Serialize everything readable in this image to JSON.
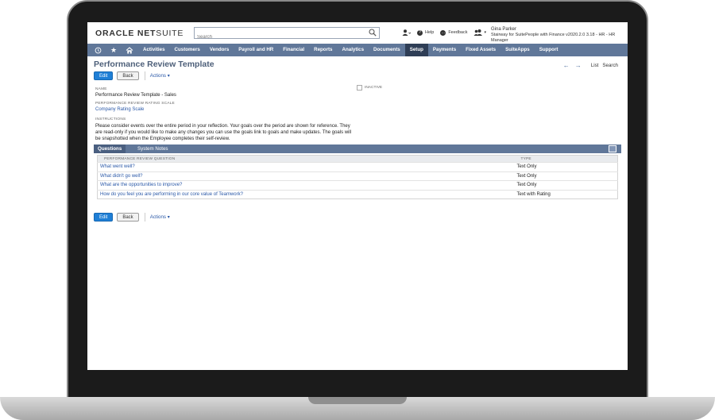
{
  "brand": {
    "oracle": "ORACLE",
    "netsuite_net": "NET",
    "netsuite_suite": "SUITE"
  },
  "search": {
    "placeholder": "Search"
  },
  "tools": {
    "help": "Help",
    "feedback": "Feedback"
  },
  "user": {
    "name": "Gina Parker",
    "role": "Stairway for SuitePeople with Finance v2020.2.0 3.18 - HR - HR Manager"
  },
  "nav": {
    "items": [
      "Activities",
      "Customers",
      "Vendors",
      "Payroll and HR",
      "Financial",
      "Reports",
      "Analytics",
      "Documents",
      "Setup",
      "Payments",
      "Fixed Assets",
      "SuiteApps",
      "Support"
    ],
    "active_index": 8
  },
  "page": {
    "title": "Performance Review Template",
    "list_link": "List",
    "search_link": "Search",
    "edit_label": "Edit",
    "back_label": "Back",
    "actions_label": "Actions ▾"
  },
  "fields": {
    "name_label": "NAME",
    "name_value": "Performance Review Template - Sales",
    "scale_label": "PERFORMANCE REVIEW RATING SCALE",
    "scale_value": "Company Rating Scale",
    "inactive_label": "INACTIVE",
    "instructions_label": "INSTRUCTIONS",
    "instructions_value": "Please consider events over the entire period in your reflection. Your goals over the period are shown for reference. They are read-only if you would like to make any changes you can use the goals link to goals and make updates. The goals will be snapshotted when the Employee completes their self-review."
  },
  "subtabs": {
    "questions": "Questions",
    "system_notes": "System Notes"
  },
  "table": {
    "headers": {
      "question": "PERFORMANCE REVIEW QUESTION",
      "type": "TYPE"
    },
    "rows": [
      {
        "question": "What went well?",
        "type": "Text Only"
      },
      {
        "question": "What didn't go well?",
        "type": "Text Only"
      },
      {
        "question": "What are the opportunities to improve?",
        "type": "Text Only"
      },
      {
        "question": "How do you feel you are performing in our core value of Teamwork?",
        "type": "Text with Rating"
      }
    ]
  },
  "colors": {
    "nav": "#607799",
    "nav_active": "#2f3e56",
    "link": "#2b59a8",
    "primary_button": "#1f7fd6"
  }
}
